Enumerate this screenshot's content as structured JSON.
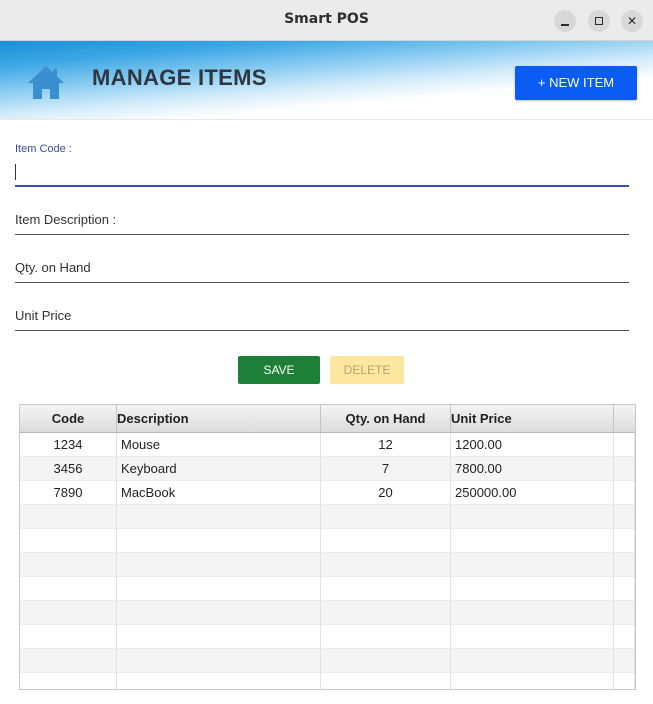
{
  "window": {
    "title": "Smart POS"
  },
  "header": {
    "title": "MANAGE ITEMS",
    "new_item_label": "+ NEW ITEM"
  },
  "form": {
    "item_code_label": "Item Code :",
    "item_code_value": "",
    "item_description_label": "Item Description :",
    "qty_label": "Qty. on Hand",
    "unit_price_label": "Unit Price"
  },
  "actions": {
    "save_label": "SAVE",
    "delete_label": "DELETE"
  },
  "table": {
    "columns": [
      "Code",
      "Description",
      "Qty. on Hand",
      "Unit Price"
    ],
    "rows": [
      {
        "code": "1234",
        "description": "Mouse",
        "qty": "12",
        "price": "1200.00"
      },
      {
        "code": "3456",
        "description": "Keyboard",
        "qty": "7",
        "price": "7800.00"
      },
      {
        "code": "7890",
        "description": "MacBook",
        "qty": "20",
        "price": "250000.00"
      }
    ],
    "empty_row_count": 8
  },
  "colors": {
    "accent": "#0a5cf4",
    "save": "#1e8038",
    "delete": "#fde7a0",
    "focus": "#3b4ea6",
    "home_icon": "#3a8fd0"
  }
}
